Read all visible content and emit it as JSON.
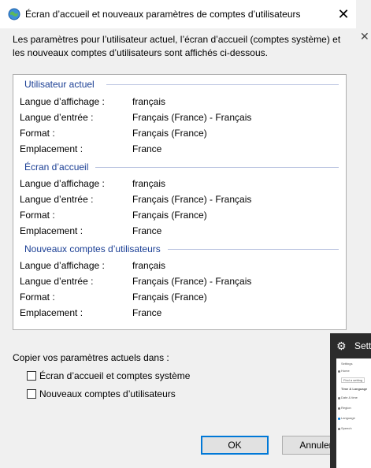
{
  "dialog": {
    "title": "Écran d’accueil et nouveaux paramètres de comptes d’utilisateurs",
    "intro": "Les paramètres pour l’utilisateur actuel, l’écran d’accueil (comptes système) et les nouveaux comptes d’utilisateurs sont affichés ci-dessous.",
    "sections": [
      {
        "title": "Utilisateur actuel",
        "rows": [
          {
            "label": "Langue d’affichage :",
            "value": "français"
          },
          {
            "label": "Langue d’entrée :",
            "value": "Français (France) - Français"
          },
          {
            "label": "Format :",
            "value": "Français (France)"
          },
          {
            "label": "Emplacement :",
            "value": "France"
          }
        ]
      },
      {
        "title": "Écran d’accueil",
        "rows": [
          {
            "label": "Langue d’affichage :",
            "value": "français"
          },
          {
            "label": "Langue d’entrée :",
            "value": "Français (France) - Français"
          },
          {
            "label": "Format :",
            "value": "Français (France)"
          },
          {
            "label": "Emplacement :",
            "value": "France"
          }
        ]
      },
      {
        "title": "Nouveaux comptes d’utilisateurs",
        "rows": [
          {
            "label": "Langue d’affichage :",
            "value": "français"
          },
          {
            "label": "Langue d’entrée :",
            "value": "Français (France) - Français"
          },
          {
            "label": "Format :",
            "value": "Français (France)"
          },
          {
            "label": "Emplacement :",
            "value": "France"
          }
        ]
      }
    ],
    "copy_label": "Copier vos paramètres actuels dans :",
    "checkboxes": [
      {
        "label": "Écran d’accueil et comptes système",
        "checked": false
      },
      {
        "label": "Nouveaux comptes d’utilisateurs",
        "checked": false
      }
    ],
    "ok_label": "OK",
    "cancel_label": "Annuler",
    "accent_color": "#0078d7",
    "section_title_color": "#1a3e94"
  },
  "settings_window": {
    "title": "Sett",
    "icon": "gear-icon",
    "menu_items": [
      "Settings",
      "Home",
      "Find a setting",
      "Time & Language",
      "Date & time",
      "Region",
      "Language",
      "Speech"
    ]
  }
}
